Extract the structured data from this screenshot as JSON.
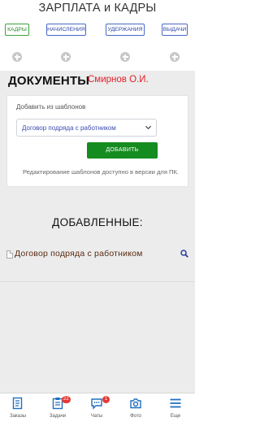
{
  "app": {
    "title": "ЗАРПЛАТА и КАДРЫ"
  },
  "tabs": [
    {
      "label": "КАДРЫ",
      "active": true
    },
    {
      "label": "НАЧИСЛЕНИЯ",
      "active": false
    },
    {
      "label": "УДЕРЖАНИЯ",
      "active": false
    },
    {
      "label": "ВЫДАЧИ",
      "active": false
    }
  ],
  "header": {
    "title": "ДОКУМЕНТЫ",
    "user_name": "Смирнов О.И."
  },
  "templates": {
    "label": "Добавить из шаблонов",
    "selected": "Договор подряда с работником",
    "add_button": "ДОБАВИТЬ",
    "hint": "Редактирование шаблонов доступно в версии для ПК."
  },
  "added": {
    "title": "ДОБАВЛЕННЫЕ:",
    "items": [
      {
        "name": "Договор подряда с работником"
      }
    ]
  },
  "bottom_nav": [
    {
      "label": "Заказы",
      "icon": "orders-icon",
      "badge": ""
    },
    {
      "label": "Задачи",
      "icon": "tasks-icon",
      "badge": "22"
    },
    {
      "label": "Чаты",
      "icon": "chat-icon",
      "badge": "1"
    },
    {
      "label": "Фото",
      "icon": "camera-icon",
      "badge": ""
    },
    {
      "label": "Еще",
      "icon": "menu-icon",
      "badge": ""
    }
  ],
  "colors": {
    "accent_green": "#158c1f",
    "tab_blue": "#4a69c8",
    "user_red": "#e0202a",
    "nav_blue": "#1f6fbf",
    "badge_red": "#e53935"
  }
}
